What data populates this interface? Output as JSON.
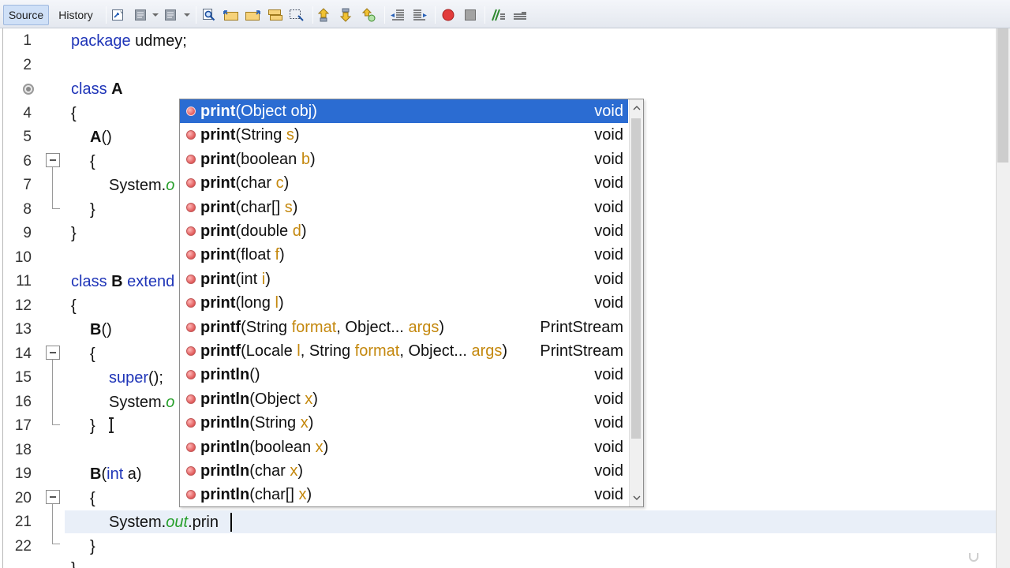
{
  "tabs": [
    {
      "label": "Source",
      "active": true
    },
    {
      "label": "History",
      "active": false
    }
  ],
  "toolbar_icons": [
    "last-edit-icon",
    "back-icon",
    "forward-icon",
    "find-icon",
    "find-previous-icon",
    "find-next-icon",
    "toggle-highlight-icon",
    "find-selection-icon",
    "previous-bookmark-icon",
    "next-bookmark-icon",
    "toggle-bookmark-icon",
    "shift-left-icon",
    "shift-right-icon",
    "start-macro-icon",
    "stop-macro-icon",
    "comment-icon",
    "uncomment-icon"
  ],
  "line_numbers": [
    "1",
    "2",
    "3",
    "4",
    "5",
    "6",
    "7",
    "8",
    "9",
    "10",
    "11",
    "12",
    "13",
    "14",
    "15",
    "16",
    "17",
    "18",
    "19",
    "20",
    "21",
    "22"
  ],
  "code": {
    "l1_kw": "package",
    "l1_rest": " udmey;",
    "l3_kw": "class",
    "l3_name": "A",
    "l4": "{",
    "l5_name": "A",
    "l5_rest": "()",
    "l6": "{",
    "l7_sys": "System.",
    "l7_out": "o",
    "l8": "}",
    "l9": "}",
    "l11_kw": "class",
    "l11_name": "B",
    "l11_kw2": "extend",
    "l12": "{",
    "l13_name": "B",
    "l13_rest": "()",
    "l14": "{",
    "l15_kw": "super",
    "l15_rest": "();",
    "l16_sys": "System.",
    "l16_out": "o",
    "l17": "}",
    "l19_name": "B",
    "l19_open": "(",
    "l19_kw": "int",
    "l19_rest": " a)",
    "l20": "{",
    "l21_sys": "System.",
    "l21_out": "out",
    "l21_rest": ".prin",
    "l22": "}",
    "l23": "}"
  },
  "completion": {
    "items": [
      {
        "name": "print",
        "params": [
          {
            "type": "Object",
            "pname": "obj"
          }
        ],
        "rtype": "void",
        "selected": true
      },
      {
        "name": "print",
        "params": [
          {
            "type": "String",
            "pname": "s"
          }
        ],
        "rtype": "void"
      },
      {
        "name": "print",
        "params": [
          {
            "type": "boolean",
            "pname": "b"
          }
        ],
        "rtype": "void"
      },
      {
        "name": "print",
        "params": [
          {
            "type": "char",
            "pname": "c"
          }
        ],
        "rtype": "void"
      },
      {
        "name": "print",
        "params": [
          {
            "type": "char[]",
            "pname": "s"
          }
        ],
        "rtype": "void"
      },
      {
        "name": "print",
        "params": [
          {
            "type": "double",
            "pname": "d"
          }
        ],
        "rtype": "void"
      },
      {
        "name": "print",
        "params": [
          {
            "type": "float",
            "pname": "f"
          }
        ],
        "rtype": "void"
      },
      {
        "name": "print",
        "params": [
          {
            "type": "int",
            "pname": "i"
          }
        ],
        "rtype": "void"
      },
      {
        "name": "print",
        "params": [
          {
            "type": "long",
            "pname": "l"
          }
        ],
        "rtype": "void"
      },
      {
        "name": "printf",
        "params": [
          {
            "type": "String",
            "pname": "format"
          },
          {
            "type": "Object...",
            "pname": "args"
          }
        ],
        "rtype": "PrintStream"
      },
      {
        "name": "printf",
        "params": [
          {
            "type": "Locale",
            "pname": "l"
          },
          {
            "type": "String",
            "pname": "format"
          },
          {
            "type": "Object...",
            "pname": "args"
          }
        ],
        "rtype": "PrintStream"
      },
      {
        "name": "println",
        "params": [],
        "rtype": "void"
      },
      {
        "name": "println",
        "params": [
          {
            "type": "Object",
            "pname": "x"
          }
        ],
        "rtype": "void"
      },
      {
        "name": "println",
        "params": [
          {
            "type": "String",
            "pname": "x"
          }
        ],
        "rtype": "void"
      },
      {
        "name": "println",
        "params": [
          {
            "type": "boolean",
            "pname": "x"
          }
        ],
        "rtype": "void"
      },
      {
        "name": "println",
        "params": [
          {
            "type": "char",
            "pname": "x"
          }
        ],
        "rtype": "void"
      },
      {
        "name": "println",
        "params": [
          {
            "type": "char[]",
            "pname": "x"
          }
        ],
        "rtype": "void"
      }
    ]
  },
  "colors": {
    "keyword": "#1f35b8",
    "field_italic": "#279f2b",
    "param_name": "#c4880e",
    "selection": "#2b6cd2",
    "current_line": "#e9eff8"
  }
}
